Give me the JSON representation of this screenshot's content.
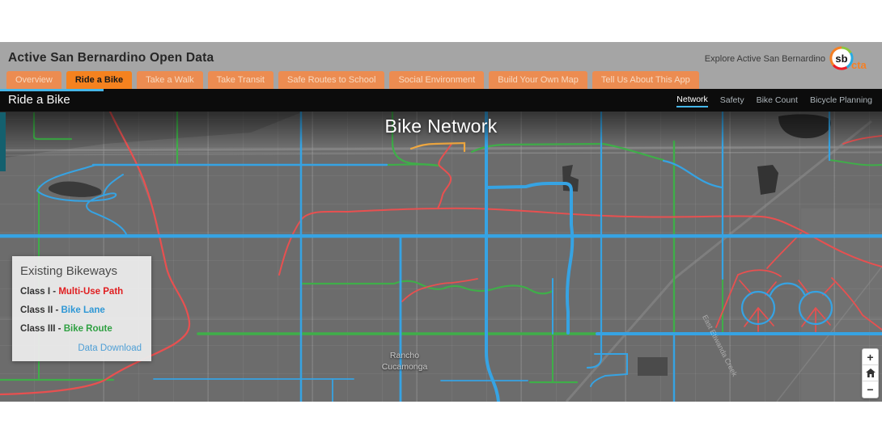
{
  "header": {
    "title": "Active San Bernardino Open Data",
    "explore_label": "Explore Active San Bernardino",
    "logo": {
      "circle_text": "sb",
      "suffix": "cta",
      "accent_color": "#f58025"
    }
  },
  "tabs": {
    "items": [
      {
        "label": "Overview",
        "active": false
      },
      {
        "label": "Ride a Bike",
        "active": true
      },
      {
        "label": "Take a Walk",
        "active": false
      },
      {
        "label": "Take Transit",
        "active": false
      },
      {
        "label": "Safe Routes to School",
        "active": false
      },
      {
        "label": "Social Environment",
        "active": false
      },
      {
        "label": "Build Your Own Map",
        "active": false
      },
      {
        "label": "Tell Us About This App",
        "active": false
      }
    ]
  },
  "sub_header": {
    "title": "Ride a Bike",
    "nav": [
      {
        "label": "Network",
        "active": true
      },
      {
        "label": "Safety",
        "active": false
      },
      {
        "label": "Bike Count",
        "active": false
      },
      {
        "label": "Bicycle Planning",
        "active": false
      }
    ]
  },
  "map": {
    "title": "Bike Network",
    "place_label_line1": "Rancho",
    "place_label_line2": "Cucamonga",
    "street_label": "East Etiwanda Creek",
    "line_colors": {
      "multi_use_path": "#e85050",
      "bike_lane": "#36a3e3",
      "bike_route": "#3fae49",
      "unclassified": "#f0a840"
    }
  },
  "legend": {
    "title": "Existing Bikeways",
    "entries": [
      {
        "class_label": "Class I - ",
        "name": "Multi-Use Path",
        "color": "#e01d1f"
      },
      {
        "class_label": "Class II - ",
        "name": "Bike Lane",
        "color": "#2e97d5"
      },
      {
        "class_label": "Class III - ",
        "name": "Bike Route",
        "color": "#2fa042"
      }
    ],
    "link_label": "Data Download"
  },
  "controls": {
    "zoom_in": "+",
    "home": "⌂",
    "zoom_out": "−"
  }
}
